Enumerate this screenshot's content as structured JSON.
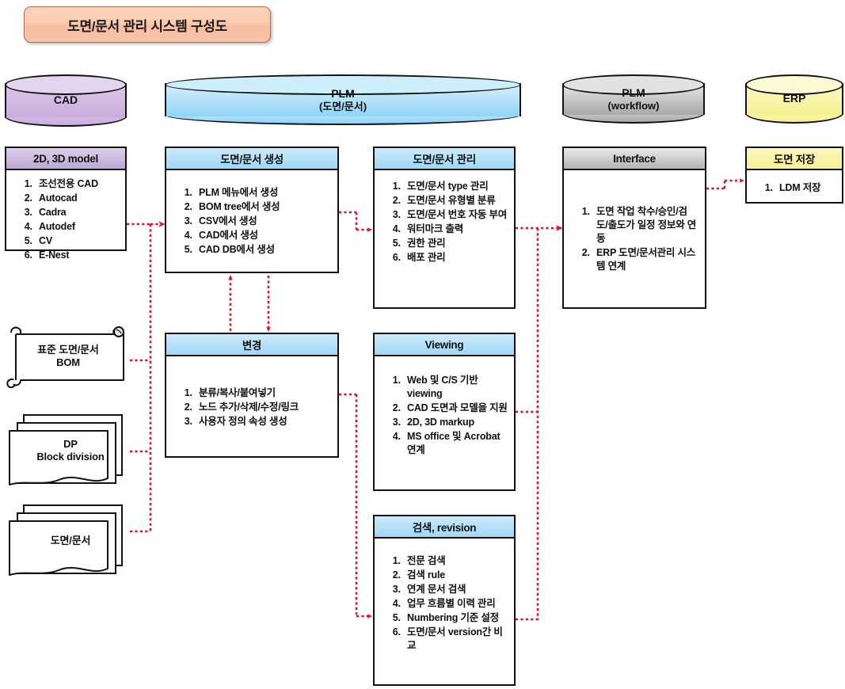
{
  "title": "도면/문서 관리 시스템 구성도",
  "cylinders": [
    {
      "name": "CAD",
      "label": "CAD",
      "sub": "",
      "color": "#c9aede"
    },
    {
      "name": "PLM",
      "label": "PLM",
      "sub": "(도면/문서)",
      "color": "#8fd4f7"
    },
    {
      "name": "PLM workflow",
      "label": "PLM",
      "sub": "(workflow)",
      "color": "#a8a8a8"
    },
    {
      "name": "ERP",
      "label": "ERP",
      "sub": "",
      "color": "#f6f08f"
    }
  ],
  "panels": {
    "model": {
      "header": "2D, 3D model",
      "items": [
        "조선전용 CAD",
        "Autocad",
        "Cadra",
        "Autodef",
        "CV",
        "E-Nest"
      ]
    },
    "create": {
      "header": "도면/문서 생성",
      "items": [
        "PLM 메뉴에서 생성",
        "BOM tree에서 생성",
        "CSV에서 생성",
        "CAD에서 생성",
        "CAD DB에서 생성"
      ]
    },
    "manage": {
      "header": "도면/문서 관리",
      "items": [
        "도면/문서 type 관리",
        "도면/문서 유형별 분류",
        "도면/문서 번호 자동 부여",
        "워터마크 출력",
        "권한 관리",
        "배포 관리"
      ]
    },
    "interface": {
      "header": "Interface",
      "items": [
        "도면 작업 착수/승인/검도/출도가 일정 정보와 연동",
        "ERP 도면/문서관리 시스템 연계"
      ]
    },
    "storage": {
      "header": "도면 저장",
      "items": [
        "LDM 저장"
      ]
    },
    "change": {
      "header": "변경",
      "items": [
        "분류/복사/붙여넣기",
        "노드 추가/삭제/수정/링크",
        "사용자 정의 속성 생성"
      ]
    },
    "viewing": {
      "header": "Viewing",
      "items": [
        "Web 및 C/S 기반 viewing",
        "CAD 도면과 모델을 지원",
        "2D, 3D markup",
        "MS office 및 Acrobat 연계"
      ]
    },
    "search": {
      "header": "검색, revision",
      "items": [
        "전문 검색",
        "검색 rule",
        "연계 문서 검색",
        "업무 흐름별 이력 관리",
        "Numbering 기준 설정",
        "도면/문서 version간 비교"
      ]
    }
  },
  "shapes": {
    "bom": {
      "line1": "표준 도면/문서",
      "line2": "BOM"
    },
    "dp": {
      "line1": "DP",
      "line2": "Block division"
    },
    "doc": {
      "line1": "도면/문서",
      "line2": ""
    }
  },
  "connector_color": "#e8112d"
}
